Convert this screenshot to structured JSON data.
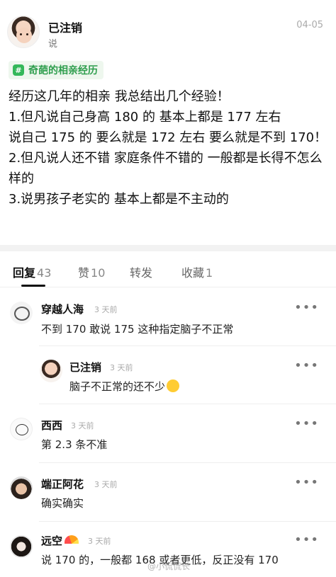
{
  "post": {
    "author": "已注销",
    "subtitle": "说",
    "date": "04-05",
    "topic": "奇葩的相亲经历",
    "body_lines": [
      "经历这几年的相亲 我总结出几个经验！",
      "1.但凡说自己身高 180 的 基本上都是 177 左右",
      "说自己 175 的 要么就是 172 左右 要么就是不到 170！",
      "2.但凡说人还不错 家庭条件不错的 一般都是长得不怎么样的",
      "3.说男孩子老实的 基本上都是不主动的"
    ]
  },
  "tabs": [
    {
      "label": "回复",
      "count": "43"
    },
    {
      "label": "赞",
      "count": "10"
    },
    {
      "label": "转发",
      "count": ""
    },
    {
      "label": "收藏",
      "count": "1"
    }
  ],
  "comments": [
    {
      "name": "穿越人海",
      "time": "3 天前",
      "text": "不到 170 敢说 175 这种指定脑子不正常",
      "avatar_icon": "doodle-avatar"
    },
    {
      "name": "已注销",
      "time": "3 天前",
      "text": "脑子不正常的还不少",
      "emoji": "laughing-tears-emoji",
      "avatar_icon": "girl-avatar"
    },
    {
      "name": "西西",
      "time": "3 天前",
      "text": "第 2.3 条不准",
      "avatar_icon": "bear-avatar"
    },
    {
      "name": "端正阿花",
      "time": "3 天前",
      "text": "确实确实",
      "avatar_icon": "man-avatar"
    },
    {
      "name": "远空",
      "time": "3 天前",
      "text": "说 170 的，一般都 168 或者更低，反正没有 170",
      "emoji": "rainbow-emoji",
      "avatar_icon": "dark-avatar"
    }
  ],
  "more_label": "•••",
  "watermark": "@小侃侃长",
  "colors": {
    "accent_green": "#2e9e4d",
    "tag_bg": "#eef7ee"
  }
}
